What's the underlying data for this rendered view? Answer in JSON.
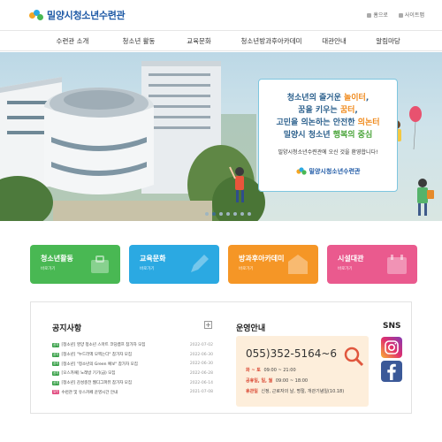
{
  "header": {
    "logo_text": "밀양시청소년수련관",
    "util": [
      "홈으로",
      "사이트맵"
    ]
  },
  "nav": {
    "items": [
      "수련관 소개",
      "청소년 활동",
      "교육문화",
      "청소년방과후아카데미",
      "대관안내",
      "알림마당"
    ]
  },
  "hero": {
    "line1_a": "청소년의 즐거운 ",
    "line1_b": "놀이터",
    "line1_c": ",",
    "line2_a": "꿈을 키우는 ",
    "line2_b": "꿈터",
    "line2_c": ",",
    "line3_a": "고민을 의논하는 안전한 ",
    "line3_b": "의논터",
    "line4_a": "밀양시 청소년 ",
    "line4_b": "행복의 중심",
    "sub": "밀양시청소년수련관에 오신 것을 환영합니다!",
    "brand": "밀양시청소년수련관",
    "slides": 7,
    "active_slide": 1
  },
  "quick_menu": [
    {
      "title": "청소년활동",
      "more": "바로가기",
      "color": "#49b853",
      "icon": "bag-icon"
    },
    {
      "title": "교육문화",
      "more": "바로가기",
      "color": "#2ba9e2",
      "icon": "pencil-icon"
    },
    {
      "title": "방과후아카데미",
      "more": "바로가기",
      "color": "#f59626",
      "icon": "school-icon"
    },
    {
      "title": "시설대관",
      "more": "바로가기",
      "color": "#ea5a8e",
      "icon": "calendar-icon"
    }
  ],
  "notice": {
    "title": "공지사항",
    "more": "+",
    "items": [
      {
        "badge": "공지",
        "badge_color": "#3aa14a",
        "title": "[청소년] 영양 청소년 스마트 코딩캠프 참가자 모집",
        "date": "2022-07-02"
      },
      {
        "badge": "공지",
        "badge_color": "#3aa14a",
        "title": "[청소년] \"누드러액 모찍는다\" 참가자 모집",
        "date": "2022-06-30"
      },
      {
        "badge": "공지",
        "badge_color": "#3aa14a",
        "title": "[청소년] \"청소년의 Green 예보\" 참가자 모집",
        "date": "2022-06-30"
      },
      {
        "badge": "공지",
        "badge_color": "#3aa14a",
        "title": "[오스카패] 노래방 기기(급) 모집",
        "date": "2022-06-28"
      },
      {
        "badge": "공지",
        "badge_color": "#3aa14a",
        "title": "[청소년] 감성충전 웹디그파뷰 참가자 모집",
        "date": "2022-06-14"
      },
      {
        "badge": "일반",
        "badge_color": "#e0457b",
        "title": "수련관 및 유스카페 운영시간 안내",
        "date": "2021-07-08"
      }
    ]
  },
  "operation": {
    "title": "운영안내",
    "phone": "055)352-5164~6",
    "weekday_label": "화 ~ 토",
    "weekday_time": "09:00 ~ 21:00",
    "weekend_label": "공휴일, 일, 월",
    "weekend_time": "09:00 ~ 18:00",
    "closed_label": "휴관일",
    "closed_text": "신정, 근로자의 날, 명절, 개관기념일(10.18)"
  },
  "sns": {
    "title": "SNS",
    "items": [
      {
        "name": "instagram",
        "icon": "instagram-icon"
      },
      {
        "name": "facebook",
        "icon": "facebook-icon"
      }
    ]
  }
}
